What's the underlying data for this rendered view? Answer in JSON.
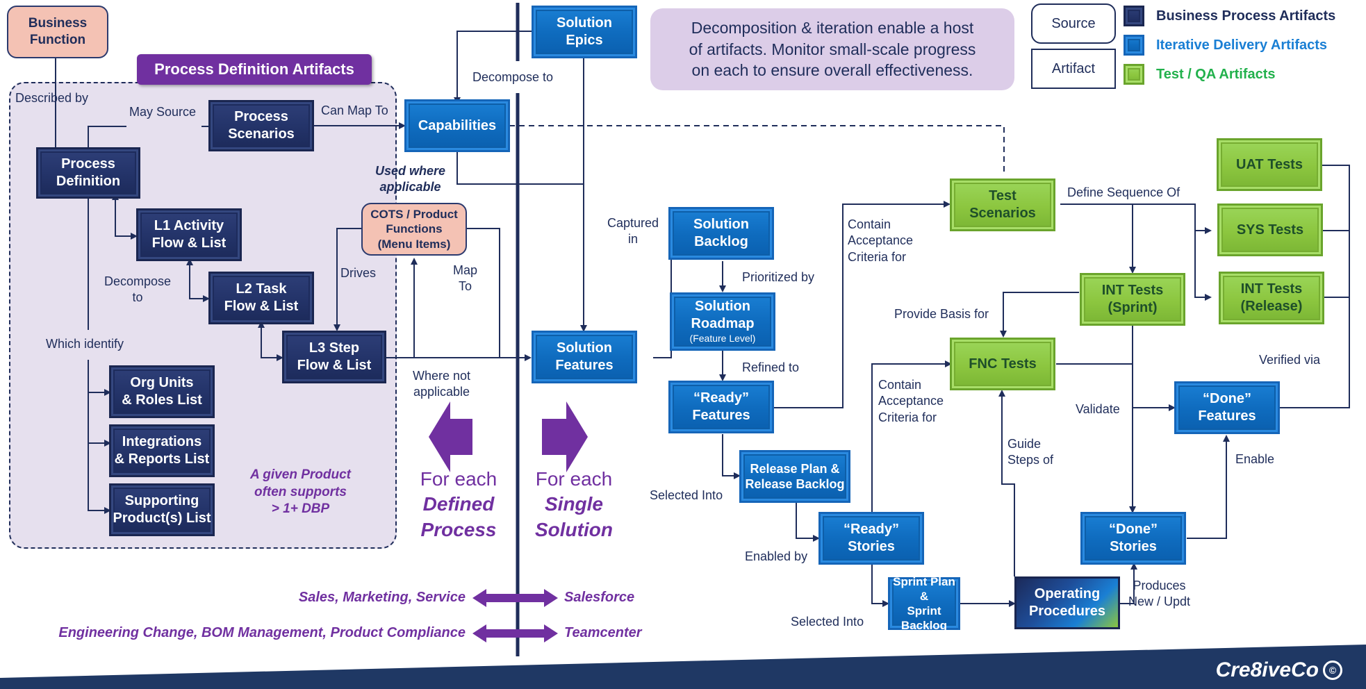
{
  "legend": {
    "source_label": "Source",
    "artifact_label": "Artifact",
    "items": [
      {
        "label": "Business Process Artifacts",
        "color": "#1f2d5a"
      },
      {
        "label": "Iterative Delivery Artifacts",
        "color": "#1a7fd4"
      },
      {
        "label": "Test / QA Artifacts",
        "color": "#22b14c"
      }
    ]
  },
  "note": "Decomposition & iteration enable a host\nof artifacts. Monitor small-scale progress\non each to ensure overall effectiveness.",
  "region": {
    "title": "Process Definition Artifacts",
    "footnote": "A given Product\noften supports\n> 1+ DBP"
  },
  "sources": {
    "business_function": "Business\nFunction",
    "cots": "COTS / Product\nFunctions\n(Menu Items)"
  },
  "business_process": {
    "process_definition": "Process\nDefinition",
    "process_scenarios": "Process\nScenarios",
    "l1": "L1 Activity\nFlow & List",
    "l2": "L2 Task\nFlow & List",
    "l3": "L3 Step\nFlow & List",
    "org_units": "Org Units\n& Roles List",
    "integrations": "Integrations\n& Reports List",
    "supporting_products": "Supporting\nProduct(s) List"
  },
  "iterative_delivery": {
    "solution_epics": "Solution\nEpics",
    "capabilities": "Capabilities",
    "solution_features": "Solution\nFeatures",
    "solution_backlog": "Solution\nBacklog",
    "solution_roadmap": "Solution\nRoadmap",
    "solution_roadmap_sub": "(Feature Level)",
    "ready_features": "“Ready”\nFeatures",
    "release_plan": "Release Plan &\nRelease Backlog",
    "ready_stories": "“Ready”\nStories",
    "sprint_plan": "Sprint Plan &\nSprint Backlog",
    "operating_procedures": "Operating\nProcedures",
    "done_stories": "“Done”\nStories",
    "done_features": "“Done”\nFeatures"
  },
  "qa": {
    "test_scenarios": "Test\nScenarios",
    "uat_tests": "UAT Tests",
    "sys_tests": "SYS Tests",
    "int_release": "INT Tests\n(Release)",
    "int_sprint": "INT Tests\n(Sprint)",
    "fnc_tests": "FNC Tests"
  },
  "edge_labels": {
    "described_by": "Described by",
    "may_source": "May Source",
    "can_map_to": "Can Map To",
    "decompose_to_l": "Decompose\nto",
    "which_identify": "Which identify",
    "drives": "Drives",
    "used_where_applicable": "Used where\napplicable",
    "map_to": "Map\nTo",
    "where_not_applicable": "Where not\napplicable",
    "decompose_to": "Decompose to",
    "captured_in": "Captured\nin",
    "prioritized_by": "Prioritized by",
    "refined_to": "Refined to",
    "selected_into_release": "Selected Into",
    "enabled_by": "Enabled by",
    "selected_into_sprint": "Selected Into",
    "contain_ac_features": "Contain\nAcceptance\nCriteria for",
    "contain_ac_stories": "Contain\nAcceptance\nCriteria for",
    "define_sequence_of": "Define Sequence Of",
    "provide_basis_for": "Provide Basis for",
    "validate": "Validate",
    "verified_via": "Verified via",
    "guide_steps_of": "Guide\nSteps of",
    "enable": "Enable",
    "produces": "Produces\nNew / Updt"
  },
  "for_each": {
    "left_prefix": "For each",
    "left_emph": "Defined\nProcess",
    "right_prefix": "For each",
    "right_emph": "Single\nSolution"
  },
  "mappings": [
    {
      "process": "Sales, Marketing, Service",
      "solution": "Salesforce"
    },
    {
      "process": "Engineering Change,  BOM Management, Product Compliance",
      "solution": "Teamcenter"
    }
  ],
  "brand": "Cre8iveCo",
  "colors": {
    "business_process": "#24346a",
    "iterative_delivery": "#0f6cbf",
    "test_qa": "#8cc63f",
    "source": "#f4c2b4",
    "accent_purple": "#7030a0",
    "line": "#1f2d5a"
  }
}
